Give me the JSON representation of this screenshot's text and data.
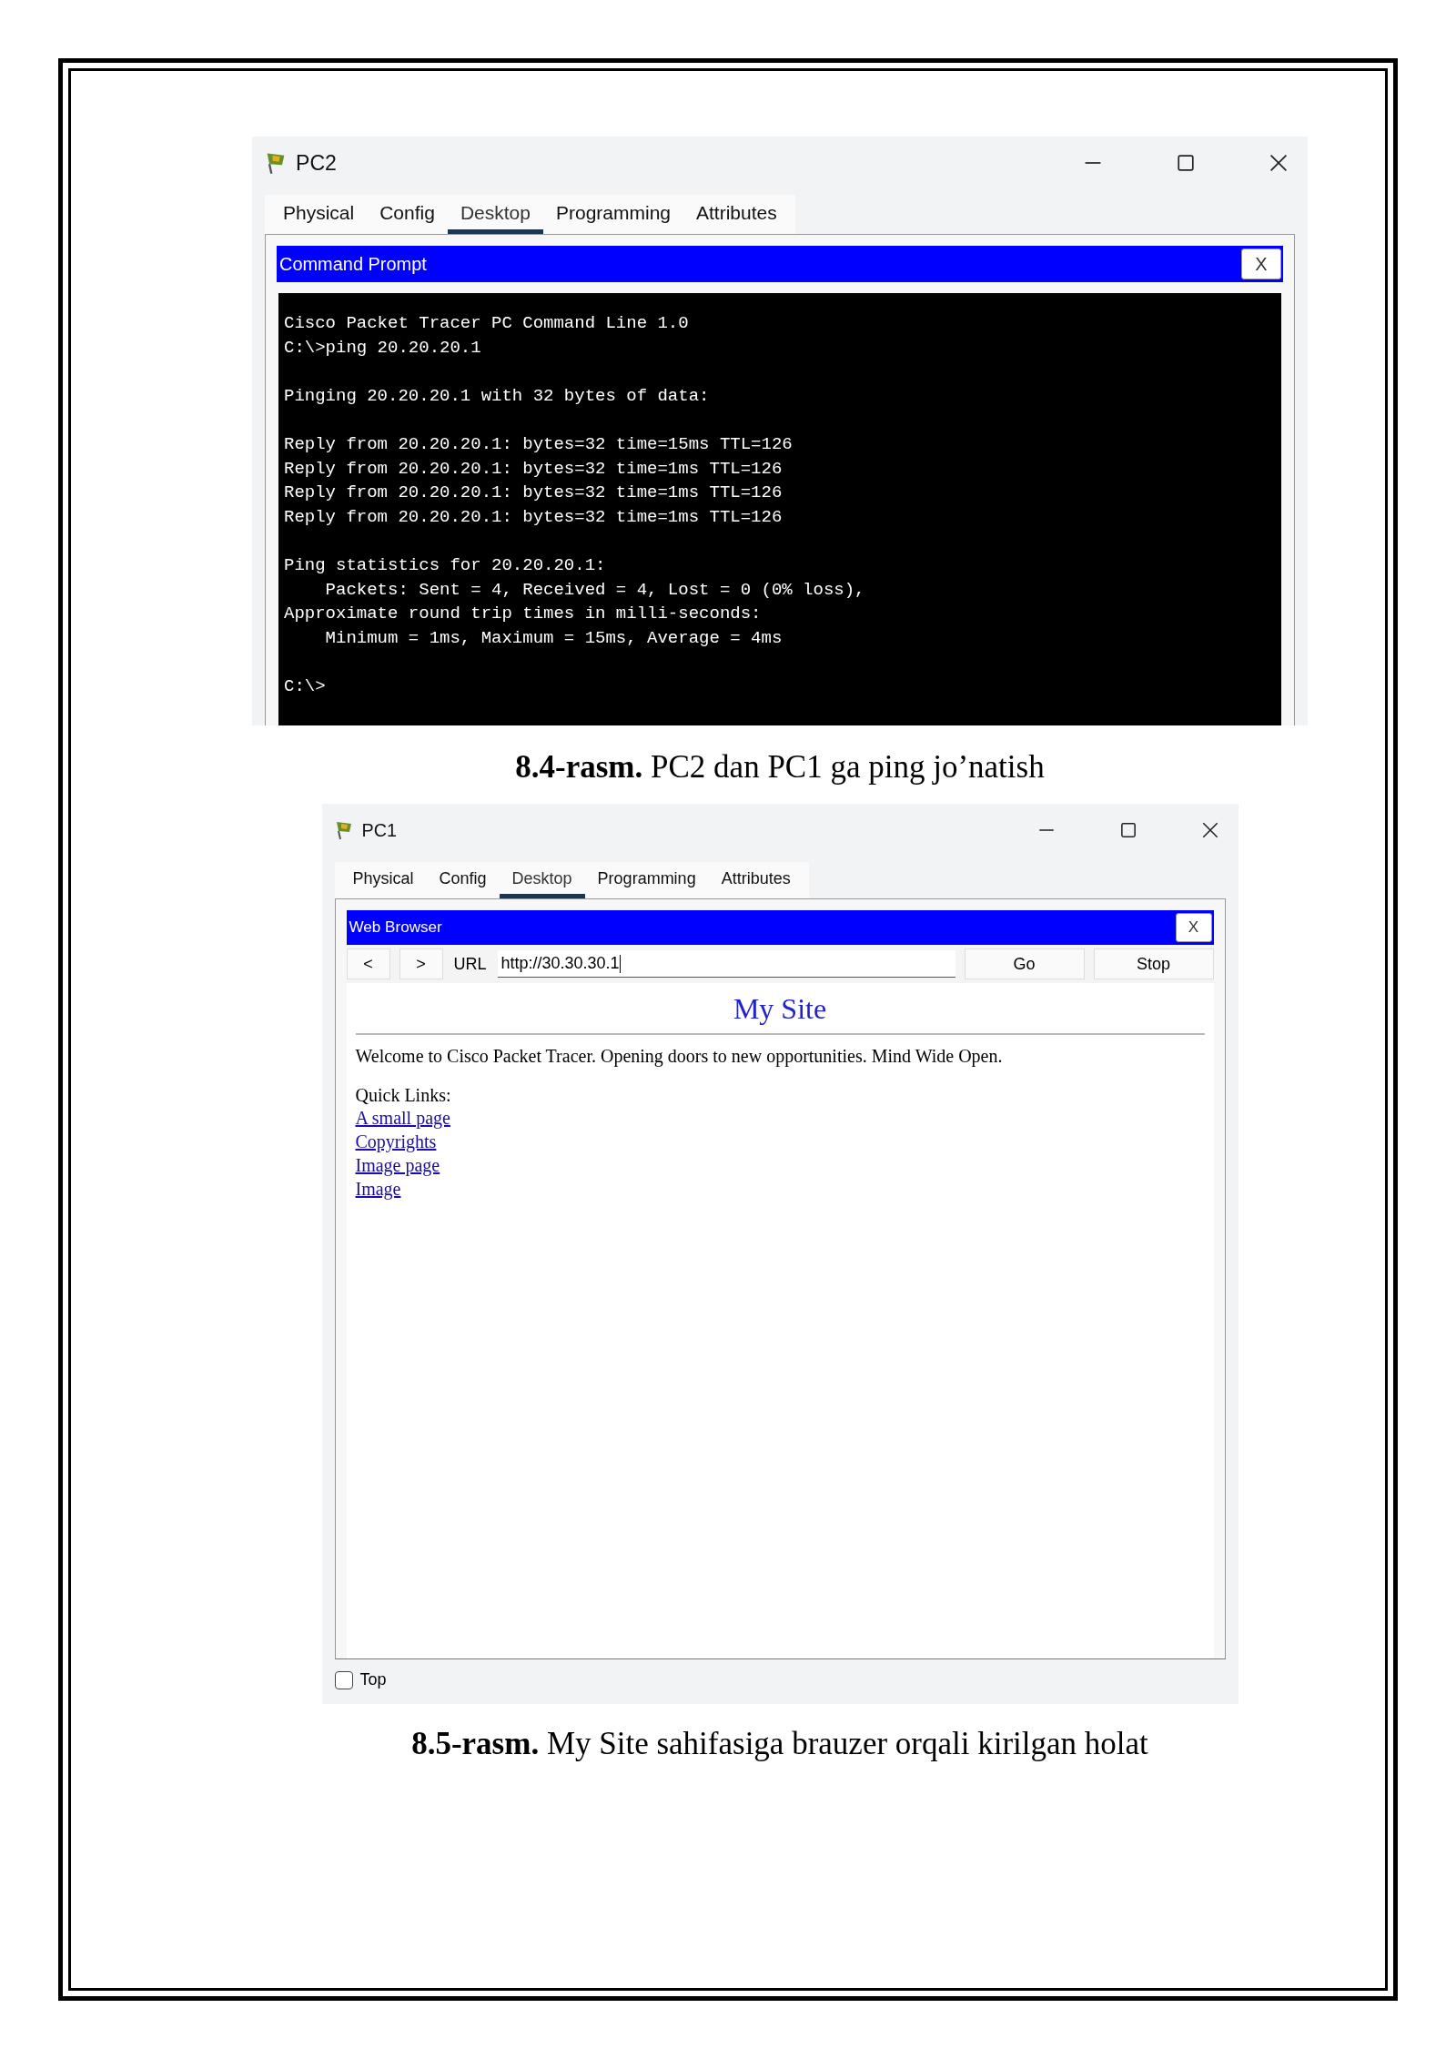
{
  "figures": [
    {
      "window": {
        "title": "PC2",
        "tabs": [
          {
            "label": "Physical",
            "selected": false
          },
          {
            "label": "Config",
            "selected": false
          },
          {
            "label": "Desktop",
            "selected": true
          },
          {
            "label": "Programming",
            "selected": false
          },
          {
            "label": "Attributes",
            "selected": false
          }
        ],
        "app": {
          "kind": "terminal",
          "title": "Command Prompt",
          "close": "X",
          "output": "Cisco Packet Tracer PC Command Line 1.0\nC:\\>ping 20.20.20.1\n\nPinging 20.20.20.1 with 32 bytes of data:\n\nReply from 20.20.20.1: bytes=32 time=15ms TTL=126\nReply from 20.20.20.1: bytes=32 time=1ms TTL=126\nReply from 20.20.20.1: bytes=32 time=1ms TTL=126\nReply from 20.20.20.1: bytes=32 time=1ms TTL=126\n\nPing statistics for 20.20.20.1:\n    Packets: Sent = 4, Received = 4, Lost = 0 (0% loss),\nApproximate round trip times in milli-seconds:\n    Minimum = 1ms, Maximum = 15ms, Average = 4ms\n\nC:\\>"
        }
      },
      "caption": {
        "number": "8.4-rasm.",
        "text": "PC2 dan PC1 ga ping jo’natish"
      }
    },
    {
      "window": {
        "title": "PC1",
        "tabs": [
          {
            "label": "Physical",
            "selected": false
          },
          {
            "label": "Config",
            "selected": false
          },
          {
            "label": "Desktop",
            "selected": true
          },
          {
            "label": "Programming",
            "selected": false
          },
          {
            "label": "Attributes",
            "selected": false
          }
        ],
        "app": {
          "kind": "browser",
          "title": "Web Browser",
          "close": "X",
          "back": "<",
          "forward": ">",
          "url_label": "URL",
          "url": "http://30.30.30.1",
          "go": "Go",
          "stop": "Stop",
          "page": {
            "heading": "My Site",
            "text": "Welcome to Cisco Packet Tracer. Opening doors to new opportunities. Mind Wide Open.",
            "links_label": "Quick Links:",
            "links": [
              "A small page",
              "Copyrights",
              "Image page",
              "Image"
            ]
          }
        },
        "top_option": {
          "label": "Top",
          "checked": false
        }
      },
      "caption": {
        "number": "8.5-rasm.",
        "text": "My Site sahifasiga brauzer orqali kirilgan holat"
      }
    }
  ]
}
